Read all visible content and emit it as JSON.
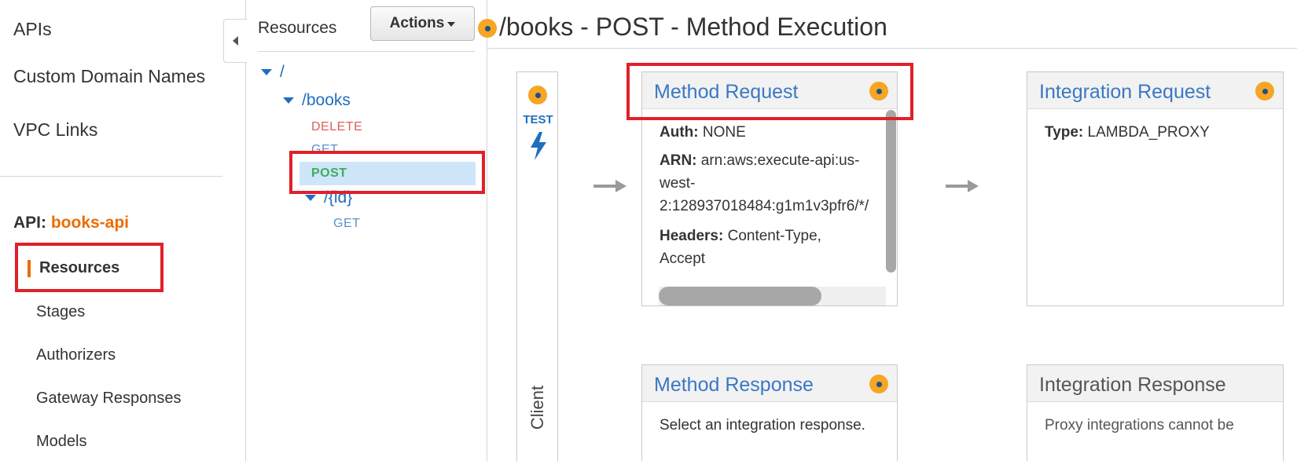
{
  "nav": {
    "apis": "APIs",
    "custom_domains": "Custom Domain Names",
    "vpc_links": "VPC Links",
    "api_label": "API:",
    "api_name": "books-api",
    "sub_items": [
      "Resources",
      "Stages",
      "Authorizers",
      "Gateway Responses",
      "Models"
    ]
  },
  "resources": {
    "title": "Resources",
    "actions_label": "Actions",
    "tree": {
      "root": "/",
      "books": "/books",
      "delete": "DELETE",
      "get": "GET",
      "post": "POST",
      "id": "/{id}",
      "id_get": "GET"
    }
  },
  "main": {
    "title": "/books - POST - Method Execution",
    "client": {
      "test_label": "TEST",
      "label": "Client"
    },
    "method_request": {
      "title": "Method Request",
      "auth_label": "Auth:",
      "auth_value": "NONE",
      "arn_label": "ARN:",
      "arn_line1": "arn:aws:execute-api:us-",
      "arn_line2": "west-",
      "arn_line3": "2:128937018484:g1m1v3pfr6/*/",
      "headers_label": "Headers:",
      "headers_line1": "Content-Type,",
      "headers_line2": "Accept"
    },
    "integration_request": {
      "title": "Integration Request",
      "type_label": "Type:",
      "type_value": "LAMBDA_PROXY"
    },
    "method_response": {
      "title": "Method Response",
      "body": "Select an integration response."
    },
    "integration_response": {
      "title": "Integration Response",
      "body": "Proxy integrations cannot be"
    }
  },
  "colors": {
    "accent_orange": "#eb6c00",
    "link_blue": "#3a78c4",
    "highlight_red": "#e0202a",
    "post_green": "#3cae5a",
    "delete_red": "#e05c5c",
    "selected_bg": "#cfe5fa"
  },
  "icons": [
    "collapse-left-icon",
    "caret-down-icon",
    "tree-expand-icon",
    "info-dot-icon",
    "lightning-icon",
    "arrow-right-icon"
  ]
}
